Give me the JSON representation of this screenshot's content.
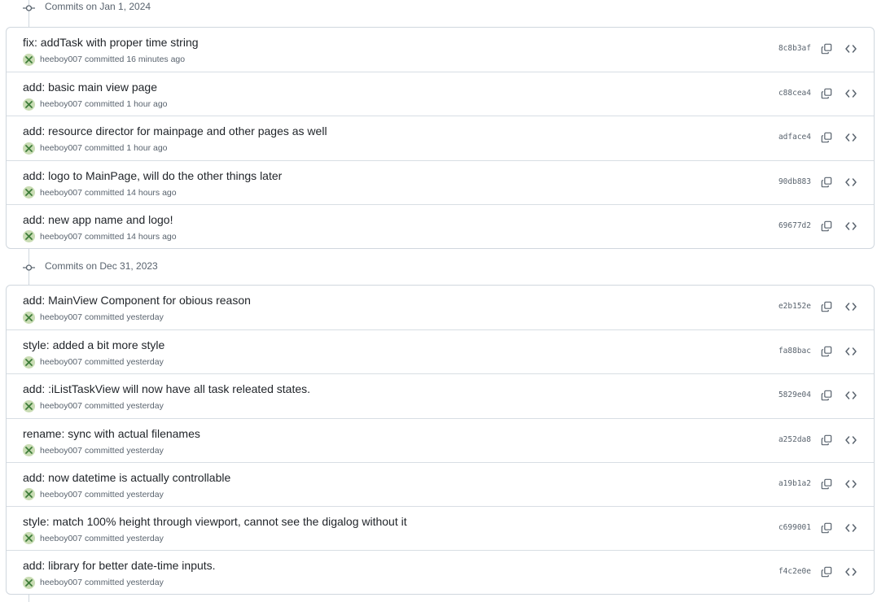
{
  "groups": [
    {
      "title": "Commits on Jan 1, 2024",
      "commits": [
        {
          "message": "fix: addTask with proper time string",
          "author": "heeboy007",
          "committed": "committed 16 minutes ago",
          "sha": "8c8b3af"
        },
        {
          "message": "add: basic main view page",
          "author": "heeboy007",
          "committed": "committed 1 hour ago",
          "sha": "c88cea4"
        },
        {
          "message": "add: resource director for mainpage and other pages as well",
          "author": "heeboy007",
          "committed": "committed 1 hour ago",
          "sha": "adface4"
        },
        {
          "message": "add: logo to MainPage, will do the other things later",
          "author": "heeboy007",
          "committed": "committed 14 hours ago",
          "sha": "90db883"
        },
        {
          "message": "add: new app name and logo!",
          "author": "heeboy007",
          "committed": "committed 14 hours ago",
          "sha": "69677d2"
        }
      ]
    },
    {
      "title": "Commits on Dec 31, 2023",
      "commits": [
        {
          "message": "add: MainView Component for obious reason",
          "author": "heeboy007",
          "committed": "committed yesterday",
          "sha": "e2b152e"
        },
        {
          "message": "style: added a bit more style",
          "author": "heeboy007",
          "committed": "committed yesterday",
          "sha": "fa88bac"
        },
        {
          "message": "add: :iListTaskView will now have all task releated states.",
          "author": "heeboy007",
          "committed": "committed yesterday",
          "sha": "5829e04"
        },
        {
          "message": "rename: sync with actual filenames",
          "author": "heeboy007",
          "committed": "committed yesterday",
          "sha": "a252da8"
        },
        {
          "message": "add: now datetime is actually controllable",
          "author": "heeboy007",
          "committed": "committed yesterday",
          "sha": "a19b1a2"
        },
        {
          "message": "style: match 100% height through viewport, cannot see the digalog without it",
          "author": "heeboy007",
          "committed": "committed yesterday",
          "sha": "c699001"
        },
        {
          "message": "add: library for better date-time inputs.",
          "author": "heeboy007",
          "committed": "committed yesterday",
          "sha": "f4c2e0e"
        }
      ]
    }
  ],
  "icons": {
    "commit": "git-commit-icon",
    "avatar": "avatar-x-icon",
    "copy": "copy-icon",
    "browse": "code-browse-icon"
  },
  "colors": {
    "border": "#d0d7de",
    "muted": "#59636e",
    "text": "#1f2328",
    "avatar_bg": "#c9dcb4",
    "avatar_x": "#3f7d3a"
  }
}
